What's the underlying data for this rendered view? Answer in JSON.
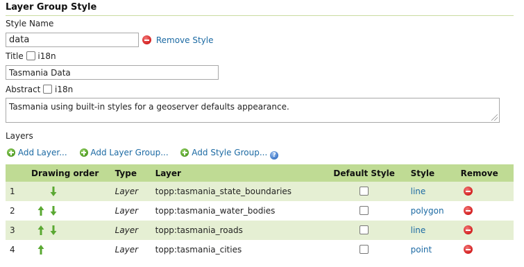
{
  "section": {
    "title": "Layer Group Style"
  },
  "style_name": {
    "label": "Style Name",
    "value": "data",
    "remove_label": "Remove Style"
  },
  "title_field": {
    "label": "Title",
    "i18n_label": "i18n",
    "value": "Tasmania Data"
  },
  "abstract_field": {
    "label": "Abstract",
    "i18n_label": "i18n",
    "value": "Tasmania using built-in styles for a geoserver defaults appearance."
  },
  "layers": {
    "heading": "Layers",
    "actions": {
      "add_layer": "Add Layer...",
      "add_layer_group": "Add Layer Group...",
      "add_style_group": "Add Style Group..."
    },
    "columns": {
      "drawing_order": "Drawing order",
      "type": "Type",
      "layer": "Layer",
      "default_style": "Default Style",
      "style": "Style",
      "remove": "Remove"
    },
    "rows": [
      {
        "index": "1",
        "type": "Layer",
        "layer": "topp:tasmania_state_boundaries",
        "style": "line",
        "up": false,
        "down": true
      },
      {
        "index": "2",
        "type": "Layer",
        "layer": "topp:tasmania_water_bodies",
        "style": "polygon",
        "up": true,
        "down": true
      },
      {
        "index": "3",
        "type": "Layer",
        "layer": "topp:tasmania_roads",
        "style": "line",
        "up": true,
        "down": true
      },
      {
        "index": "4",
        "type": "Layer",
        "layer": "topp:tasmania_cities",
        "style": "point",
        "up": true,
        "down": false
      }
    ]
  },
  "colors": {
    "header_bg": "#bfdb94",
    "row_alt_bg": "#e5efd3",
    "link": "#1c6aa3",
    "arrow": "#5aa832"
  }
}
